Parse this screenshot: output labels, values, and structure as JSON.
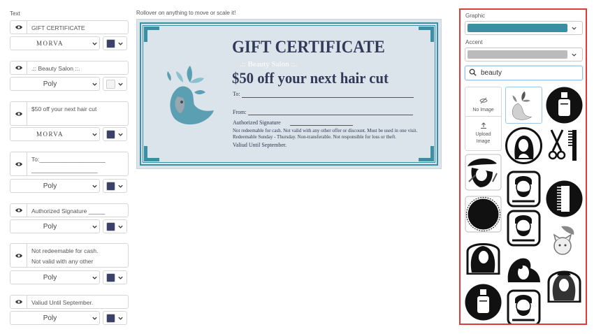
{
  "left_panel": {
    "title": "Text",
    "fields": [
      {
        "text": "GIFT CERTIFICATE",
        "font": "MORVA",
        "color": "#3b4168"
      },
      {
        "text": ".:: Beauty Salon ::.",
        "font": "Poly",
        "color": "#f3f3f3"
      },
      {
        "text": "$50 off your next hair cut",
        "font": "MORVA",
        "color": "#3b4168"
      },
      {
        "text": "To:____________________\n____________________",
        "font": "Poly",
        "color": "#3b4168"
      },
      {
        "text": "Authorized Signature _____",
        "font": "Poly",
        "color": "#3b4168"
      },
      {
        "text": "Not redeemable for cash.\nNot valid with any other\noffer or discount. Must be",
        "font": "Poly",
        "color": "#3b4168"
      },
      {
        "text": "Valiud Until September.",
        "font": "Poly",
        "color": "#3b4168"
      }
    ]
  },
  "hint": "Rollover on anything to move or scale it!",
  "certificate": {
    "title": "GIFT CERTIFICATE",
    "salon": ".:: Beauty Salon ::.",
    "offer": "$50 off your next hair cut",
    "to": "To:",
    "from": "From:",
    "signature": "Authorized Signature",
    "terms_line1": "Not redeemable for cash. Not valid with any other offer or discount. Must be used in one visit.",
    "terms_line2": "Redeemable Sunday - Thursday. Non-transferable. Not responsible for loss or theft.",
    "valid": "Valiud Until September.",
    "frame_color": "#3a8fa3",
    "background": "#dbe4ea"
  },
  "right_panel": {
    "graphic_label": "Graphic",
    "graphic_color": "#3a8fa3",
    "accent_label": "Accent",
    "accent_color": "#bbbbbb",
    "search_value": "beauty",
    "no_image_label": "No Image",
    "upload_label_1": "Upload",
    "upload_label_2": "Image",
    "tiles": [
      "no-image",
      "woman-plant-graphic",
      "bottle-badge",
      "upload-image",
      "woman-portrait-badge",
      "scissors-comb",
      "woman-hat-graphic",
      "bearded-man-frame",
      "comb-badge",
      "round-badge",
      "bearded-man-frame",
      "cat-graphic",
      "woman-hair-arch",
      "panda-graphic",
      "woman-curly-hair",
      "bottle-badge",
      "bearded-man-frame",
      "woman-curly-arch"
    ]
  }
}
